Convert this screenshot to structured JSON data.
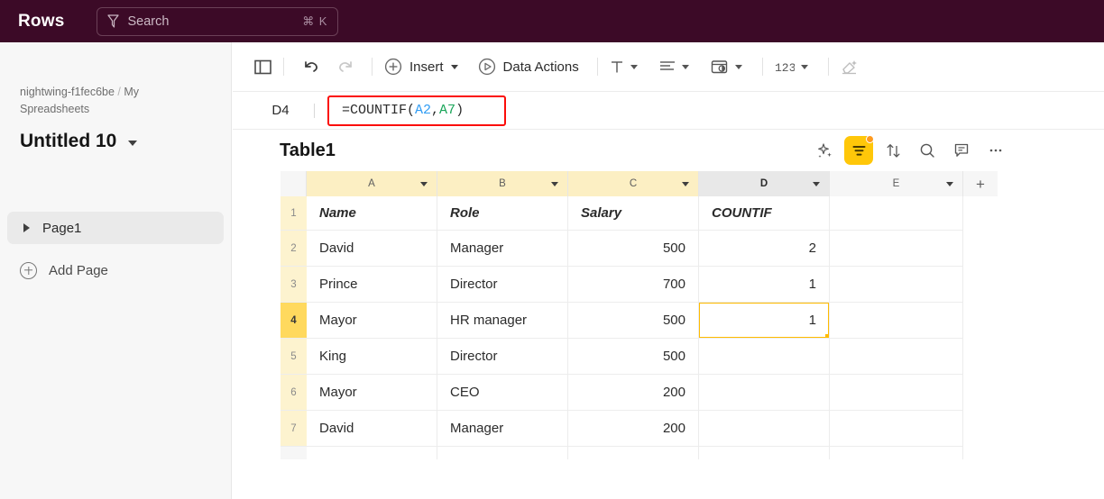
{
  "app": {
    "brand": "Rows",
    "header_bg": "#3c0a27",
    "accent": "#ffc709",
    "annotation_color": "#fb0d09"
  },
  "search": {
    "placeholder": "Search",
    "shortcut": "⌘ K",
    "icon": "filter-icon"
  },
  "sidebar": {
    "breadcrumb_workspace": "nightwing-f1fec6be",
    "breadcrumb_separator": "/",
    "breadcrumb_section": "My Spreadsheets",
    "doc_title": "Untitled 10",
    "page_item": "Page1",
    "add_page": "Add Page"
  },
  "toolbar": {
    "panel_toggle": "panel-toggle-icon",
    "undo": "undo-icon",
    "redo": "redo-icon",
    "insert_label": "Insert",
    "data_actions_label": "Data Actions",
    "text_format": "text-format-icon",
    "align": "align-icon",
    "fill_color": "fill-color-icon",
    "number_format": "number-format-icon",
    "clear_format": "clear-format-icon"
  },
  "formula_bar": {
    "cell_reference": "D4",
    "formula_prefix": "=COUNTIF(",
    "ref_1": "A2",
    "comma": ",",
    "ref_2": "A7",
    "formula_suffix": ")"
  },
  "table": {
    "name": "Table1",
    "actions": [
      "ai-sparkle-icon",
      "filter-icon",
      "sort-icon",
      "search-icon",
      "comment-icon",
      "more-options-icon"
    ],
    "filter_active": true,
    "columns": [
      {
        "letter": "A",
        "state": "filtered"
      },
      {
        "letter": "B",
        "state": "filtered"
      },
      {
        "letter": "C",
        "state": "filtered"
      },
      {
        "letter": "D",
        "state": "selected"
      },
      {
        "letter": "E",
        "state": "plain"
      }
    ],
    "add_column": "+",
    "header_row": {
      "number": "1",
      "cells": [
        "Name",
        "Role",
        "Salary",
        "COUNTIF",
        ""
      ]
    },
    "rows": [
      {
        "number": "2",
        "cells": [
          "David",
          "Manager",
          "500",
          "2",
          ""
        ],
        "active": false
      },
      {
        "number": "3",
        "cells": [
          "Prince",
          "Director",
          "700",
          "1",
          ""
        ],
        "active": false
      },
      {
        "number": "4",
        "cells": [
          "Mayor",
          "HR manager",
          "500",
          "1",
          ""
        ],
        "active": true
      },
      {
        "number": "5",
        "cells": [
          "King",
          "Director",
          "500",
          "",
          ""
        ],
        "active": false
      },
      {
        "number": "6",
        "cells": [
          "Mayor",
          "CEO",
          "200",
          "",
          ""
        ],
        "active": false
      },
      {
        "number": "7",
        "cells": [
          "David",
          "Manager",
          "200",
          "",
          ""
        ],
        "active": false
      }
    ],
    "selected_cell": {
      "column_index": 3,
      "row_index": 2
    }
  }
}
